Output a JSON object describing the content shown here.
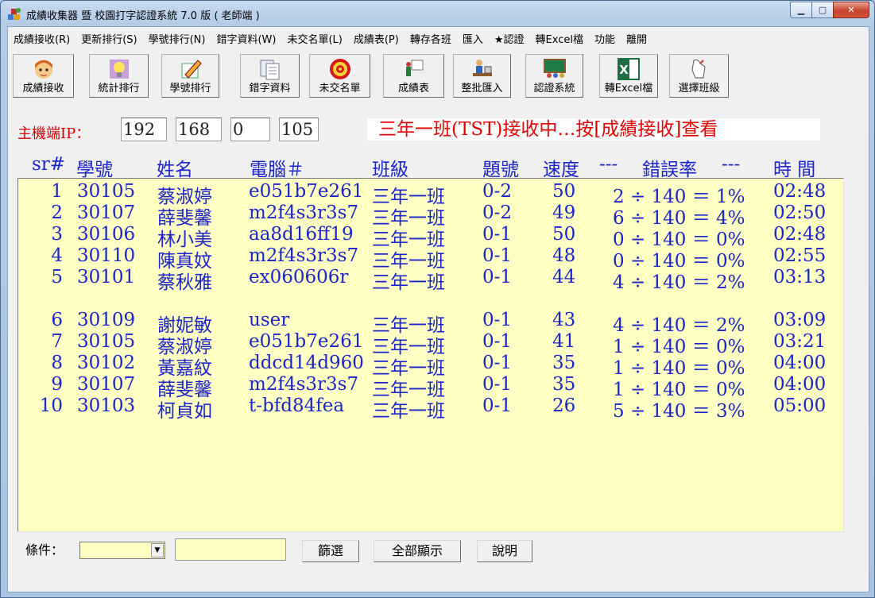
{
  "window": {
    "title": "成績收集器 暨 校園打字認證系統 7.0 版 ( 老師端 )"
  },
  "menu": [
    "成績接收(R)",
    "更新排行(S)",
    "學號排行(N)",
    "錯字資料(W)",
    "未交名單(L)",
    "成績表(P)",
    "轉存各班",
    "匯入",
    "★認證",
    "轉Excel檔",
    "功能",
    "離開"
  ],
  "toolbar": [
    {
      "label": "成績接收",
      "icon": "face-icon"
    },
    {
      "label": "統計排行",
      "icon": "lightbulb-icon"
    },
    {
      "label": "學號排行",
      "icon": "pencil-icon"
    },
    {
      "label": "錯字資料",
      "icon": "documents-icon"
    },
    {
      "label": "未交名單",
      "icon": "target-icon"
    },
    {
      "label": "成績表",
      "icon": "presenter-icon"
    },
    {
      "label": "整批匯入",
      "icon": "person-desk-icon"
    },
    {
      "label": "認證系統",
      "icon": "classroom-icon"
    },
    {
      "label": "轉Excel檔",
      "icon": "excel-icon"
    },
    {
      "label": "選擇班級",
      "icon": "hand-pointer-icon"
    }
  ],
  "host": {
    "label": "主機端IP：",
    "ip": [
      "192",
      "168",
      "0",
      "105"
    ],
    "status": "三年一班(TST)接收中…按[成績接收]查看"
  },
  "columns": [
    "sr#",
    "學號",
    "姓名",
    "電腦＃",
    "班級",
    "題號",
    "速度",
    "---",
    "錯誤率",
    "---",
    "時  間"
  ],
  "rows": [
    {
      "sr": "1",
      "id": "30105",
      "name": "蔡淑婷",
      "pc": "e051b7e261",
      "cls": "三年一班",
      "q": "0-2",
      "speed": "50",
      "err": "2 ÷ 140 ＝ 1%",
      "time": "02:48"
    },
    {
      "sr": "2",
      "id": "30107",
      "name": "薛斐馨",
      "pc": "m2f4s3r3s7",
      "cls": "三年一班",
      "q": "0-2",
      "speed": "49",
      "err": "6 ÷ 140 ＝ 4%",
      "time": "02:50"
    },
    {
      "sr": "3",
      "id": "30106",
      "name": "林小美",
      "pc": "aa8d16ff19",
      "cls": "三年一班",
      "q": "0-1",
      "speed": "50",
      "err": "0 ÷ 140 ＝ 0%",
      "time": "02:48"
    },
    {
      "sr": "4",
      "id": "30110",
      "name": "陳真妏",
      "pc": "m2f4s3r3s7",
      "cls": "三年一班",
      "q": "0-1",
      "speed": "48",
      "err": "0 ÷ 140 ＝ 0%",
      "time": "02:55"
    },
    {
      "sr": "5",
      "id": "30101",
      "name": "蔡秋雅",
      "pc": "ex060606r",
      "cls": "三年一班",
      "q": "0-1",
      "speed": "44",
      "err": "4 ÷ 140 ＝ 2%",
      "time": "03:13"
    },
    {
      "sr": "6",
      "id": "30109",
      "name": "謝妮敏",
      "pc": "user",
      "cls": "三年一班",
      "q": "0-1",
      "speed": "43",
      "err": "4 ÷ 140 ＝ 2%",
      "time": "03:09"
    },
    {
      "sr": "7",
      "id": "30105",
      "name": "蔡淑婷",
      "pc": "e051b7e261",
      "cls": "三年一班",
      "q": "0-1",
      "speed": "41",
      "err": "1 ÷ 140 ＝ 0%",
      "time": "03:21"
    },
    {
      "sr": "8",
      "id": "30102",
      "name": "黃嘉紋",
      "pc": "ddcd14d960",
      "cls": "三年一班",
      "q": "0-1",
      "speed": "35",
      "err": "1 ÷ 140 ＝ 0%",
      "time": "04:00"
    },
    {
      "sr": "9",
      "id": "30107",
      "name": "薛斐馨",
      "pc": "m2f4s3r3s7",
      "cls": "三年一班",
      "q": "0-1",
      "speed": "35",
      "err": "1 ÷ 140 ＝ 0%",
      "time": "04:00"
    },
    {
      "sr": "10",
      "id": "30103",
      "name": "柯貞如",
      "pc": "t-bfd84fea",
      "cls": "三年一班",
      "q": "0-1",
      "speed": "26",
      "err": "5 ÷ 140 ＝ 3%",
      "time": "05:00"
    }
  ],
  "filter": {
    "label": "條件：",
    "combo_value": "",
    "text_value": "",
    "buttons": [
      "篩選",
      "全部顯示",
      "說明"
    ]
  },
  "colors": {
    "header_text": "#1b25c9",
    "status_text": "#e20000",
    "list_bg": "#ffffc4"
  }
}
